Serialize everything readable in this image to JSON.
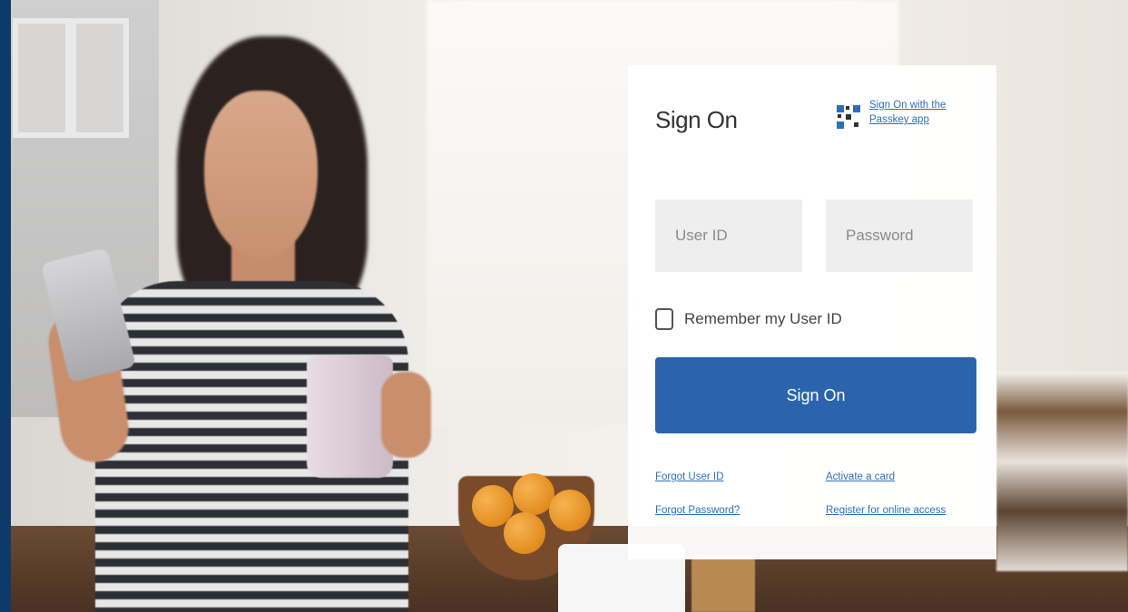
{
  "signon": {
    "title": "Sign On",
    "passkey_link": "Sign On with the Passkey app",
    "user_id_placeholder": "User ID",
    "password_placeholder": "Password",
    "remember_label": "Remember my User ID",
    "signon_button": "Sign On",
    "links": {
      "forgot_user_id": "Forgot User ID",
      "forgot_password": "Forgot Password?",
      "activate_card": "Activate a card",
      "register_online": "Register for online access"
    }
  },
  "icons": {
    "passkey": "qr-code-icon",
    "remember": "checkbox-icon"
  },
  "colors": {
    "brand_blue": "#2b64ad",
    "link_blue": "#2f6fb5",
    "field_bg": "#eeeeee",
    "left_edge": "#0d3a6b"
  }
}
